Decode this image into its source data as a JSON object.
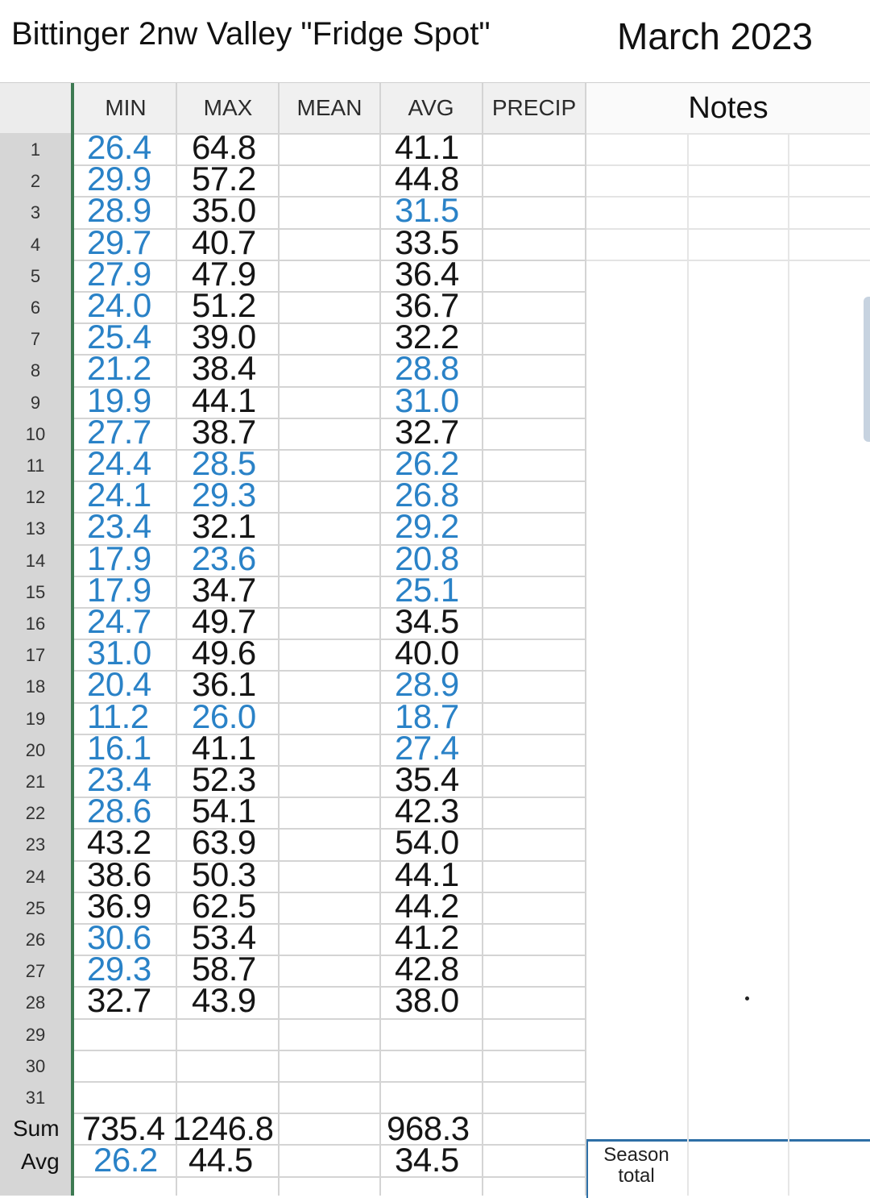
{
  "page": {
    "title": "Bittinger 2nw Valley \"Fridge Spot\"",
    "month": "March 2023"
  },
  "columns": {
    "min": "MIN",
    "max": "MAX",
    "mean": "MEAN",
    "avg": "AVG",
    "precip": "PRECIP",
    "notes": "Notes"
  },
  "rows": [
    {
      "n": "1",
      "min": "26.4",
      "max": "64.8",
      "avg": "41.1",
      "minColor": "blue",
      "maxColor": "black",
      "avgColor": "black"
    },
    {
      "n": "2",
      "min": "29.9",
      "max": "57.2",
      "avg": "44.8",
      "minColor": "blue",
      "maxColor": "black",
      "avgColor": "black"
    },
    {
      "n": "3",
      "min": "28.9",
      "max": "35.0",
      "avg": "31.5",
      "minColor": "blue",
      "maxColor": "black",
      "avgColor": "blue"
    },
    {
      "n": "4",
      "min": "29.7",
      "max": "40.7",
      "avg": "33.5",
      "minColor": "blue",
      "maxColor": "black",
      "avgColor": "black"
    },
    {
      "n": "5",
      "min": "27.9",
      "max": "47.9",
      "avg": "36.4",
      "minColor": "blue",
      "maxColor": "black",
      "avgColor": "black"
    },
    {
      "n": "6",
      "min": "24.0",
      "max": "51.2",
      "avg": "36.7",
      "minColor": "blue",
      "maxColor": "black",
      "avgColor": "black"
    },
    {
      "n": "7",
      "min": "25.4",
      "max": "39.0",
      "avg": "32.2",
      "minColor": "blue",
      "maxColor": "black",
      "avgColor": "black"
    },
    {
      "n": "8",
      "min": "21.2",
      "max": "38.4",
      "avg": "28.8",
      "minColor": "blue",
      "maxColor": "black",
      "avgColor": "blue"
    },
    {
      "n": "9",
      "min": "19.9",
      "max": "44.1",
      "avg": "31.0",
      "minColor": "blue",
      "maxColor": "black",
      "avgColor": "blue"
    },
    {
      "n": "10",
      "min": "27.7",
      "max": "38.7",
      "avg": "32.7",
      "minColor": "blue",
      "maxColor": "black",
      "avgColor": "black"
    },
    {
      "n": "11",
      "min": "24.4",
      "max": "28.5",
      "avg": "26.2",
      "minColor": "blue",
      "maxColor": "blue",
      "avgColor": "blue"
    },
    {
      "n": "12",
      "min": "24.1",
      "max": "29.3",
      "avg": "26.8",
      "minColor": "blue",
      "maxColor": "blue",
      "avgColor": "blue"
    },
    {
      "n": "13",
      "min": "23.4",
      "max": "32.1",
      "avg": "29.2",
      "minColor": "blue",
      "maxColor": "black",
      "avgColor": "blue"
    },
    {
      "n": "14",
      "min": "17.9",
      "max": "23.6",
      "avg": "20.8",
      "minColor": "blue",
      "maxColor": "blue",
      "avgColor": "blue"
    },
    {
      "n": "15",
      "min": "17.9",
      "max": "34.7",
      "avg": "25.1",
      "minColor": "blue",
      "maxColor": "black",
      "avgColor": "blue"
    },
    {
      "n": "16",
      "min": "24.7",
      "max": "49.7",
      "avg": "34.5",
      "minColor": "blue",
      "maxColor": "black",
      "avgColor": "black"
    },
    {
      "n": "17",
      "min": "31.0",
      "max": "49.6",
      "avg": "40.0",
      "minColor": "blue",
      "maxColor": "black",
      "avgColor": "black"
    },
    {
      "n": "18",
      "min": "20.4",
      "max": "36.1",
      "avg": "28.9",
      "minColor": "blue",
      "maxColor": "black",
      "avgColor": "blue"
    },
    {
      "n": "19",
      "min": "11.2",
      "max": "26.0",
      "avg": "18.7",
      "minColor": "blue",
      "maxColor": "blue",
      "avgColor": "blue"
    },
    {
      "n": "20",
      "min": "16.1",
      "max": "41.1",
      "avg": "27.4",
      "minColor": "blue",
      "maxColor": "black",
      "avgColor": "blue"
    },
    {
      "n": "21",
      "min": "23.4",
      "max": "52.3",
      "avg": "35.4",
      "minColor": "blue",
      "maxColor": "black",
      "avgColor": "black"
    },
    {
      "n": "22",
      "min": "28.6",
      "max": "54.1",
      "avg": "42.3",
      "minColor": "blue",
      "maxColor": "black",
      "avgColor": "black"
    },
    {
      "n": "23",
      "min": "43.2",
      "max": "63.9",
      "avg": "54.0",
      "minColor": "black",
      "maxColor": "black",
      "avgColor": "black"
    },
    {
      "n": "24",
      "min": "38.6",
      "max": "50.3",
      "avg": "44.1",
      "minColor": "black",
      "maxColor": "black",
      "avgColor": "black"
    },
    {
      "n": "25",
      "min": "36.9",
      "max": "62.5",
      "avg": "44.2",
      "minColor": "black",
      "maxColor": "black",
      "avgColor": "black"
    },
    {
      "n": "26",
      "min": "30.6",
      "max": "53.4",
      "avg": "41.2",
      "minColor": "blue",
      "maxColor": "black",
      "avgColor": "black"
    },
    {
      "n": "27",
      "min": "29.3",
      "max": "58.7",
      "avg": "42.8",
      "minColor": "blue",
      "maxColor": "black",
      "avgColor": "black"
    },
    {
      "n": "28",
      "min": "32.7",
      "max": "43.9",
      "avg": "38.0",
      "minColor": "black",
      "maxColor": "black",
      "avgColor": "black"
    },
    {
      "n": "29",
      "min": "",
      "max": "",
      "avg": "",
      "minColor": "black",
      "maxColor": "black",
      "avgColor": "black"
    },
    {
      "n": "30",
      "min": "",
      "max": "",
      "avg": "",
      "minColor": "black",
      "maxColor": "black",
      "avgColor": "black"
    },
    {
      "n": "31",
      "min": "",
      "max": "",
      "avg": "",
      "minColor": "black",
      "maxColor": "black",
      "avgColor": "black"
    }
  ],
  "summary": {
    "sum_label": "Sum",
    "sum_min": "735.4",
    "sum_max": "1246.8",
    "sum_avg": "968.3",
    "avg_label": "Avg",
    "avg_min": "26.2",
    "avg_max": "44.5",
    "avg_avg": "34.5"
  },
  "season": {
    "label_line1": "Season",
    "label_line2": "total"
  },
  "colors": {
    "cold_blue": "#2a82c7",
    "text_black": "#151515",
    "frozen_pane_green": "#3d7a52",
    "selection_blue": "#2e6fa6"
  }
}
